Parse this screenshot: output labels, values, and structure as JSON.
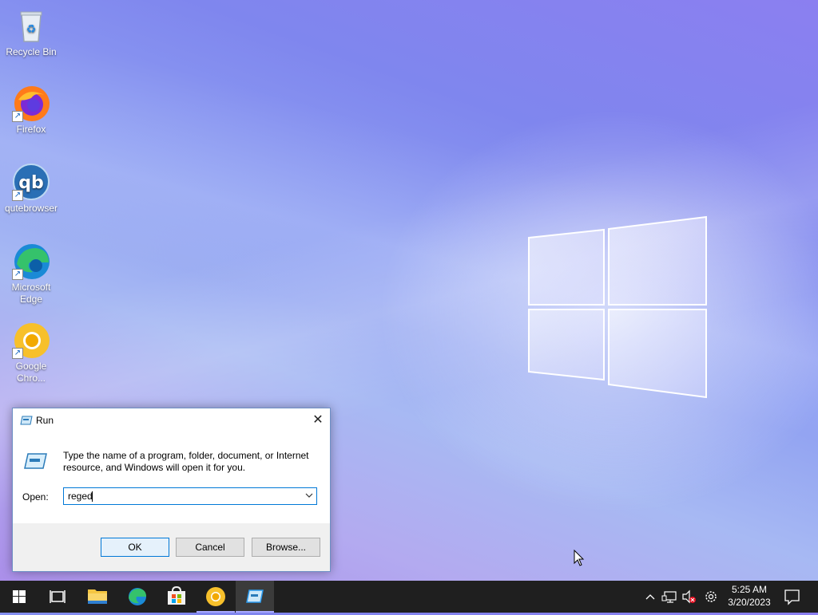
{
  "desktop": {
    "icons": [
      {
        "label": "Recycle Bin",
        "icon": "recycle-bin-icon"
      },
      {
        "label": "Firefox",
        "icon": "firefox-icon"
      },
      {
        "label": "qutebrowser",
        "icon": "qutebrowser-icon"
      },
      {
        "label": "Microsoft Edge",
        "icon": "edge-icon"
      },
      {
        "label": "Google Chro...",
        "icon": "chrome-icon"
      }
    ]
  },
  "run_dialog": {
    "title": "Run",
    "close_glyph": "✕",
    "description": "Type the name of a program, folder, document, or Internet resource, and Windows will open it for you.",
    "open_label": "Open:",
    "open_value": "reged",
    "ok_label": "OK",
    "cancel_label": "Cancel",
    "browse_label": "Browse..."
  },
  "taskbar": {
    "items": [
      "start-button",
      "task-view",
      "file-explorer",
      "microsoft-edge",
      "microsoft-store",
      "google-chrome",
      "run"
    ],
    "active": "run",
    "clock": {
      "time": "5:25 AM",
      "date": "3/20/2023"
    }
  },
  "colors": {
    "accent": "#0078d7",
    "taskbar": "#1f1f1f",
    "active_underline": "#a8a8ff"
  }
}
